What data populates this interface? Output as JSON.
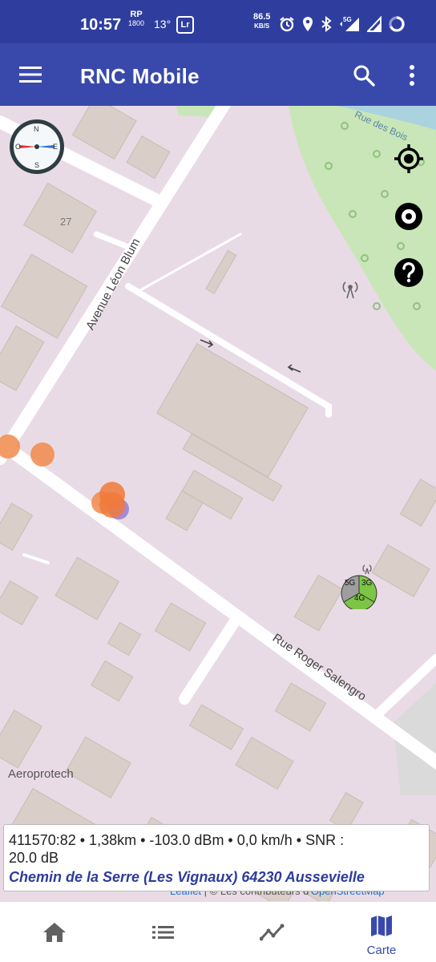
{
  "status_bar": {
    "time": "10:57",
    "rp_top": "RP",
    "rp_bottom": "1800",
    "temperature": "13°",
    "lr_badge": "Lr",
    "net_speed_value": "86.5",
    "net_speed_unit": "KB/S",
    "network_badge": "5G",
    "icons": [
      "alarm-icon",
      "location-icon",
      "bluetooth-icon",
      "signal-5g-icon",
      "signal-icon",
      "battery-icon"
    ]
  },
  "app_bar": {
    "title": "RNC Mobile",
    "color": "#3949ab",
    "icons": [
      "menu-icon",
      "search-icon",
      "more-vert-icon"
    ]
  },
  "map": {
    "street_labels": [
      "Avenue Léon Blum",
      "Rue Roger Salengro",
      "Rue des Bois",
      "Aeroprotech"
    ],
    "building_number": "27",
    "cell_marker": {
      "labels": [
        "5G",
        "3G",
        "4G"
      ],
      "colors": [
        "#9e9e9e",
        "#7cc545",
        "#7cc545"
      ]
    },
    "measure_colors": [
      "#f08a4b",
      "#9b7ad0"
    ],
    "controls": [
      "compass-icon",
      "my-location-icon",
      "target-icon",
      "help-icon"
    ],
    "compass": {
      "n": "N",
      "s": "S",
      "e": "E",
      "w": "O"
    }
  },
  "info": {
    "line1": "411570:82 • 1,38km • -103.0 dBm • 0,0 km/h • SNR :",
    "line2": "20.0 dB",
    "address": "Chemin de la Serre (Les Vignaux) 64230 Aussevielle"
  },
  "attribution": {
    "leaflet": "Leaflet",
    "separator": " | © Les contributeurs d'",
    "osm": "OpenStreetMap"
  },
  "bottom_nav": {
    "items": [
      {
        "icon": "home-icon",
        "label": ""
      },
      {
        "icon": "list-icon",
        "label": ""
      },
      {
        "icon": "chart-icon",
        "label": ""
      },
      {
        "icon": "map-icon",
        "label": "Carte"
      }
    ],
    "active_color": "#3949ab",
    "inactive_color": "#616161"
  }
}
